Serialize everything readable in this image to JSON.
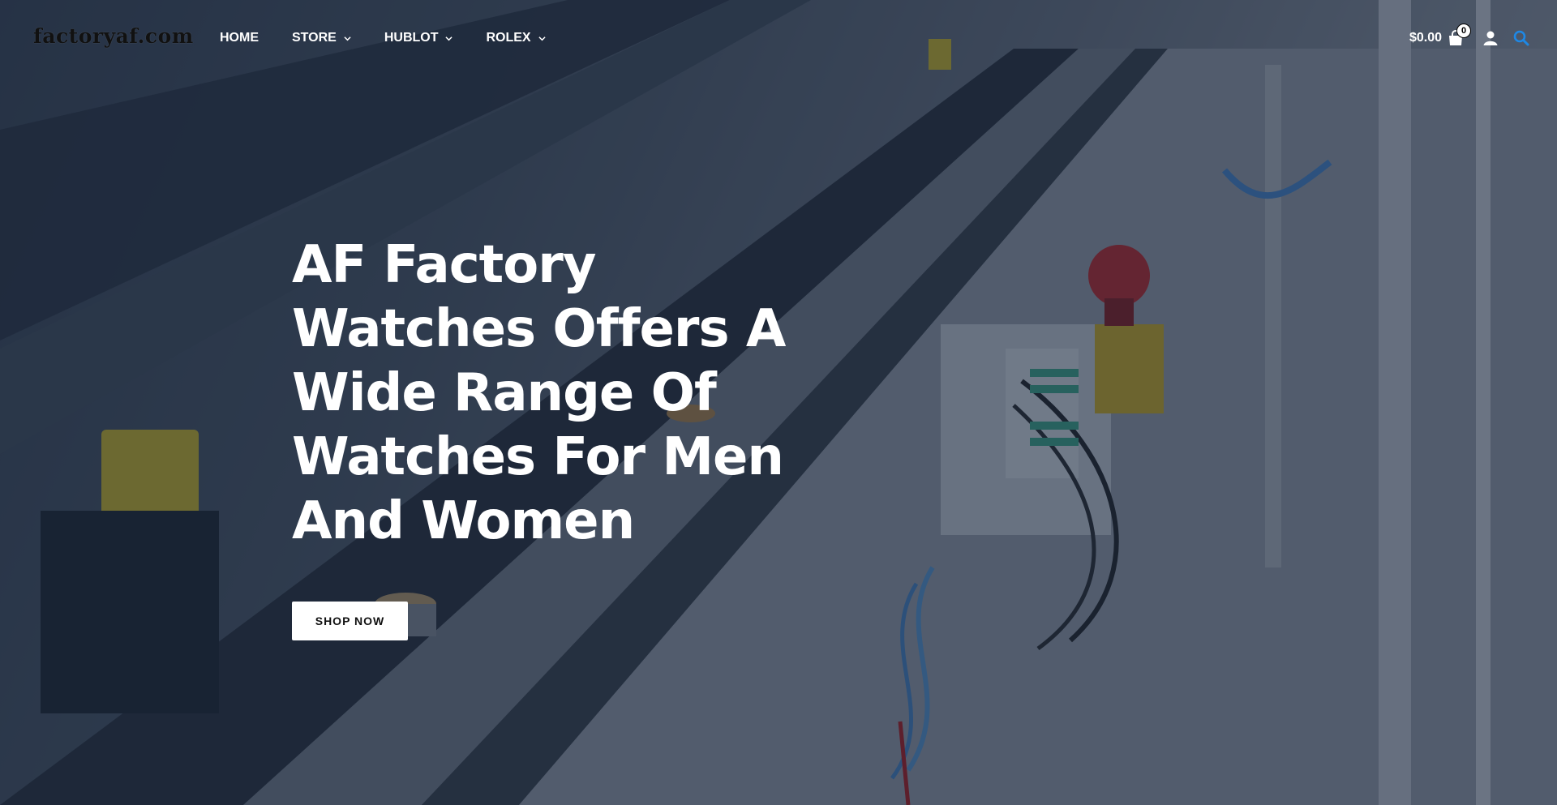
{
  "header": {
    "logo_text": "factoryaf.com",
    "nav": [
      {
        "label": "HOME",
        "has_dropdown": false
      },
      {
        "label": "STORE",
        "has_dropdown": true
      },
      {
        "label": "HUBLOT",
        "has_dropdown": true
      },
      {
        "label": "ROLEX",
        "has_dropdown": true
      }
    ],
    "cart_total": "$0.00",
    "cart_count": "0",
    "icons": {
      "cart": "shopping-bag-icon",
      "account": "user-icon",
      "search": "search-icon"
    },
    "search_icon_color": "#1e88e5"
  },
  "hero": {
    "title": "AF Factory Watches Offers A Wide Range Of Watches For Men And Women",
    "cta_label": "SHOP NOW"
  }
}
